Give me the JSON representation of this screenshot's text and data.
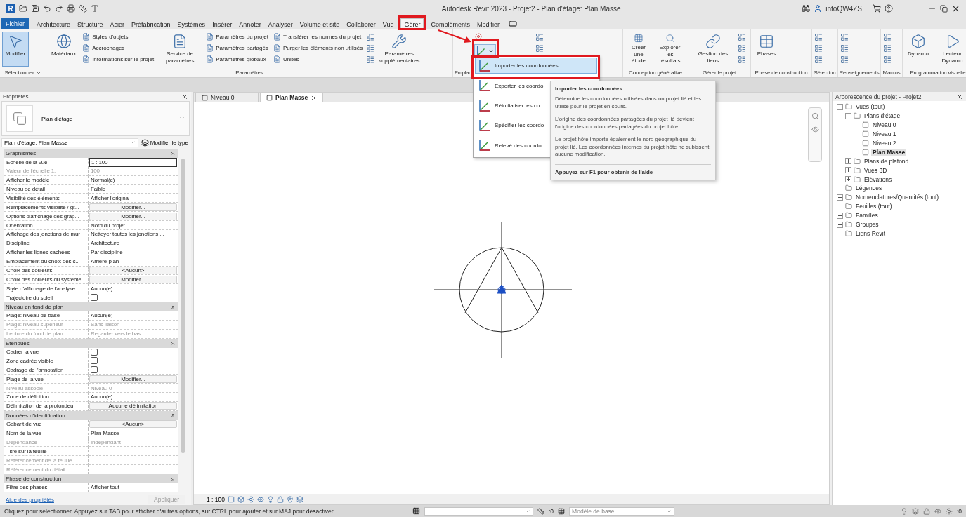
{
  "window": {
    "app_logo": "R",
    "title": "Autodesk Revit 2023 - Projet2 - Plan d'étage: Plan Masse",
    "user": "infoQW4ZS"
  },
  "file_tab": "Fichier",
  "ribbon_tabs": [
    {
      "label": "Architecture",
      "selected": false
    },
    {
      "label": "Structure",
      "selected": false
    },
    {
      "label": "Acier",
      "selected": false
    },
    {
      "label": "Préfabrication",
      "selected": false
    },
    {
      "label": "Systèmes",
      "selected": false
    },
    {
      "label": "Insérer",
      "selected": false
    },
    {
      "label": "Annoter",
      "selected": false
    },
    {
      "label": "Analyser",
      "selected": false
    },
    {
      "label": "Volume et site",
      "selected": false
    },
    {
      "label": "Collaborer",
      "selected": false
    },
    {
      "label": "Vue",
      "selected": false
    },
    {
      "label": "Gérer",
      "selected": true
    },
    {
      "label": "Compléments",
      "selected": false
    },
    {
      "label": "Modifier",
      "selected": false
    }
  ],
  "ribbon_panels": [
    {
      "title": "Sélectionner",
      "dropdown": true,
      "items": [
        {
          "kind": "large",
          "label": "Modifier",
          "active": true
        }
      ]
    },
    {
      "title": "Paramètres",
      "items": [
        {
          "kind": "large",
          "label": "Matériaux",
          "active": false
        },
        {
          "kind": "stack",
          "labels": [
            "Styles d'objets",
            "Accrochages",
            "Informations sur le projet"
          ]
        },
        {
          "kind": "large",
          "label": "Service de paramètres",
          "active": false
        },
        {
          "kind": "stack",
          "labels": [
            "Paramètres du projet",
            "Paramètres partagés",
            "Paramètres  globaux"
          ]
        },
        {
          "kind": "stack",
          "labels": [
            "Transférer les normes du projet",
            "Purger les éléments non utilisés",
            "Unités"
          ]
        },
        {
          "kind": "icons"
        },
        {
          "kind": "large",
          "label": "Paramètres supplémentaires",
          "active": false
        }
      ]
    },
    {
      "title": "Emplac",
      "items": [
        {
          "kind": "split"
        }
      ]
    },
    {
      "items": [
        {
          "kind": "icons"
        }
      ]
    },
    {
      "title": "Conception générative",
      "items": [
        {
          "kind": "large",
          "label": "Créer une étude",
          "active": false
        },
        {
          "kind": "large",
          "label": "Explorer les résultats",
          "active": false
        }
      ]
    },
    {
      "title": "Gérer le projet",
      "items": [
        {
          "kind": "large",
          "label": "Gestion des liens",
          "active": false
        },
        {
          "kind": "icons"
        }
      ]
    },
    {
      "title": "Phase de construction",
      "items": [
        {
          "kind": "large",
          "label": "Phases",
          "active": false
        }
      ]
    },
    {
      "title": "Sélection",
      "items": [
        {
          "kind": "icons"
        }
      ]
    },
    {
      "title": "Renseignements",
      "items": [
        {
          "kind": "icons"
        }
      ]
    },
    {
      "title": "Macros",
      "items": [
        {
          "kind": "icons"
        }
      ]
    },
    {
      "title": "Programmation visuelle",
      "items": [
        {
          "kind": "large",
          "label": "Dynamo",
          "active": false
        },
        {
          "kind": "large",
          "label": "Lecteur Dynamo",
          "active": false
        }
      ]
    }
  ],
  "coordinates_menu": {
    "items": [
      {
        "label": "Importer les coordonnées",
        "selected": true
      },
      {
        "label": "Exporter les coordo",
        "selected": false
      },
      {
        "label": "Réinitialiser les co",
        "selected": false
      },
      {
        "label": "Spécifier les coordo",
        "selected": false
      },
      {
        "label": "Relevé des coordo",
        "selected": false
      }
    ]
  },
  "tooltip": {
    "title": "Importer les coordonnées",
    "paragraphs": [
      "Détermine les coordonnées utilisées dans un projet lié et les utilise pour le projet en cours.",
      "L'origine des coordonnées partagées du projet lié devient l'origine des coordonnées partagées du projet hôte.",
      "Le projet hôte importe également le nord géographique du projet lié. Les coordonnées internes du projet hôte ne subissent aucune modification."
    ],
    "help": "Appuyez sur F1 pour obtenir de l'aide"
  },
  "properties": {
    "title": "Propriétés",
    "type": "Plan d'étage",
    "instance": "Plan d'étage: Plan Masse",
    "edit_type": "Modifier le type",
    "groups": [
      {
        "title": "Graphismes",
        "rows": [
          {
            "label": "Echelle de la vue",
            "value": "1 : 100",
            "kind": "input",
            "disabled": false
          },
          {
            "label": "Valeur de l'échelle    1:",
            "value": "100",
            "kind": "text",
            "disabled": true
          },
          {
            "label": "Afficher le modèle",
            "value": "Normal(e)",
            "kind": "text",
            "disabled": false
          },
          {
            "label": "Niveau de détail",
            "value": "Faible",
            "kind": "text",
            "disabled": false
          },
          {
            "label": "Visibilité des éléments",
            "value": "Afficher l'original",
            "kind": "text",
            "disabled": false
          },
          {
            "label": "Remplacements visibilité / gr...",
            "value": "Modifier...",
            "kind": "button",
            "disabled": false
          },
          {
            "label": "Options d'affichage des grap...",
            "value": "Modifier...",
            "kind": "button",
            "disabled": false
          },
          {
            "label": "Orientation",
            "value": "Nord du projet",
            "kind": "text",
            "disabled": false
          },
          {
            "label": "Affichage des jonctions de mur",
            "value": "Nettoyer toutes les jonctions ...",
            "kind": "text",
            "disabled": false
          },
          {
            "label": "Discipline",
            "value": "Architecture",
            "kind": "text",
            "disabled": false
          },
          {
            "label": "Afficher les lignes cachées",
            "value": "Par discipline",
            "kind": "text",
            "disabled": false
          },
          {
            "label": "Emplacement du choix des c...",
            "value": "Arrière-plan",
            "kind": "text",
            "disabled": false
          },
          {
            "label": "Choix des couleurs",
            "value": "<Aucun>",
            "kind": "button",
            "disabled": false
          },
          {
            "label": "Choix des couleurs du système",
            "value": "Modifier...",
            "kind": "button",
            "disabled": false
          },
          {
            "label": "Style d'affichage de l'analyse ...",
            "value": "Aucun(e)",
            "kind": "text",
            "disabled": false
          },
          {
            "label": "Trajectoire du soleil",
            "kind": "checkbox",
            "checked": false,
            "disabled": false
          }
        ]
      },
      {
        "title": "Niveau en fond de plan",
        "rows": [
          {
            "label": "Plage: niveau de base",
            "value": "Aucun(e)",
            "kind": "text",
            "disabled": false
          },
          {
            "label": "Plage: niveau supérieur",
            "value": "Sans liaison",
            "kind": "text",
            "disabled": true
          },
          {
            "label": "Lecture du fond de plan",
            "value": "Regarder vers le bas",
            "kind": "text",
            "disabled": true
          }
        ]
      },
      {
        "title": "Etendues",
        "rows": [
          {
            "label": "Cadrer la vue",
            "kind": "checkbox",
            "checked": false,
            "disabled": false
          },
          {
            "label": "Zone cadrée visible",
            "kind": "checkbox",
            "checked": false,
            "disabled": false
          },
          {
            "label": "Cadrage de l'annotation",
            "kind": "checkbox",
            "checked": false,
            "disabled": false
          },
          {
            "label": "Plage de la vue",
            "value": "Modifier...",
            "kind": "button",
            "disabled": false
          },
          {
            "label": "Niveau associé",
            "value": "Niveau 0",
            "kind": "text",
            "disabled": true
          },
          {
            "label": "Zone de définition",
            "value": "Aucun(e)",
            "kind": "text",
            "disabled": false
          },
          {
            "label": "Délimitation de la profondeur",
            "value": "Aucune délimitation",
            "kind": "button",
            "disabled": false
          }
        ]
      },
      {
        "title": "Données d'identification",
        "rows": [
          {
            "label": "Gabarit de vue",
            "value": "<Aucun>",
            "kind": "button",
            "disabled": false
          },
          {
            "label": "Nom de la vue",
            "value": "Plan Masse",
            "kind": "text",
            "disabled": false
          },
          {
            "label": "Dépendance",
            "value": "Indépendant",
            "kind": "text",
            "disabled": true
          },
          {
            "label": "Titre sur la feuille",
            "kind": "text",
            "disabled": false
          },
          {
            "label": "Référencement de la feuille",
            "kind": "text",
            "disabled": true
          },
          {
            "label": "Référencement du détail",
            "kind": "text",
            "disabled": true
          }
        ]
      },
      {
        "title": "Phase de construction",
        "rows": [
          {
            "label": "Filtre des phases",
            "value": "Afficher tout",
            "kind": "text",
            "disabled": false
          }
        ]
      }
    ],
    "help_link": "Aide des propriétés",
    "apply": "Appliquer"
  },
  "view_tabs": [
    {
      "label": "Niveau 0",
      "selected": false
    },
    {
      "label": "Plan Masse",
      "selected": true
    }
  ],
  "view_scale": "1 : 100",
  "project_browser": {
    "title": "Arborescence du projet - Projet2",
    "tree": [
      {
        "label": "Vues (tout)",
        "expanded": true,
        "children": [
          {
            "label": "Plans d'étage",
            "expanded": true,
            "children": [
              {
                "label": "Niveau 0",
                "selected": false
              },
              {
                "label": "Niveau 1",
                "selected": false
              },
              {
                "label": "Niveau 2",
                "selected": false
              },
              {
                "label": "Plan Masse",
                "selected": true
              }
            ]
          },
          {
            "label": "Plans de plafond",
            "expanded": false
          },
          {
            "label": "Vues 3D",
            "expanded": false
          },
          {
            "label": "Elévations",
            "expanded": false
          }
        ]
      },
      {
        "label": "Légendes"
      },
      {
        "label": "Nomenclatures/Quantités (tout)",
        "expanded": false
      },
      {
        "label": "Feuilles (tout)"
      },
      {
        "label": "Familles",
        "expanded": false
      },
      {
        "label": "Groupes",
        "expanded": false
      },
      {
        "label": "Liens Revit"
      }
    ]
  },
  "status_bar": {
    "message": "Cliquez pour sélectionner. Appuyez sur TAB pour afficher d'autres options, sur CTRL pour ajouter et sur MAJ pour désactiver.",
    "editing_count": ":0",
    "design_option": "Modèle de base",
    "selection_count": ":0"
  }
}
